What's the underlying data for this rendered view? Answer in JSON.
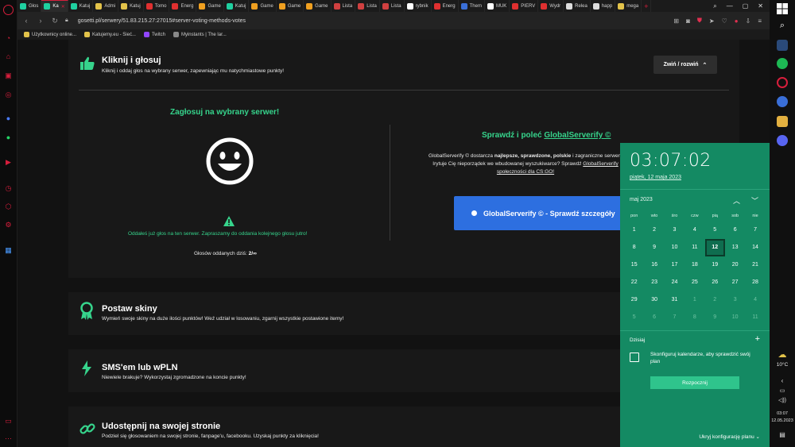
{
  "browser": {
    "tabs": [
      {
        "label": "Głos",
        "color": "#1fd0a0"
      },
      {
        "label": "Ka",
        "color": "#1fd0a0",
        "active": true
      },
      {
        "label": "Katuj",
        "color": "#1fd0a0"
      },
      {
        "label": "Admi",
        "color": "#e3c34a"
      },
      {
        "label": "Katuj",
        "color": "#e3c34a"
      },
      {
        "label": "Tomo",
        "color": "#e03030"
      },
      {
        "label": "Energ",
        "color": "#e03030"
      },
      {
        "label": "Game",
        "color": "#f0a020"
      },
      {
        "label": "Katuj",
        "color": "#1fd0a0"
      },
      {
        "label": "Game",
        "color": "#f0a020"
      },
      {
        "label": "Game",
        "color": "#f0a020"
      },
      {
        "label": "Game",
        "color": "#f0a020"
      },
      {
        "label": "Lista",
        "color": "#d04040"
      },
      {
        "label": "Lista",
        "color": "#d04040"
      },
      {
        "label": "Lista",
        "color": "#d04040"
      },
      {
        "label": "rybnik",
        "color": "#ffffff"
      },
      {
        "label": "Energ",
        "color": "#e03030"
      },
      {
        "label": "Them",
        "color": "#3a6fd8"
      },
      {
        "label": "MUK",
        "color": "#ffffff"
      },
      {
        "label": "PIERV",
        "color": "#e03030"
      },
      {
        "label": "Wydr",
        "color": "#e03030"
      },
      {
        "label": "Relea",
        "color": "#dddddd"
      },
      {
        "label": "happ",
        "color": "#dddddd"
      },
      {
        "label": "mega",
        "color": "#e3c34a"
      }
    ],
    "url": "gosetti.pl/serwery/51.83.215.27:27015#server-voting-methods-votes",
    "bookmarks": [
      "Użytkownicy online...",
      "Katujemy.eu - Sieć...",
      "Twitch",
      "Myinstants | The lar..."
    ]
  },
  "vote_card": {
    "title": "Kliknij i głosuj",
    "desc": "Kliknij i oddaj głos na wybrany serwer, zapewniając mu natychmiastowe punkty!",
    "collapse": "Zwiń / rozwiń",
    "vote_title": "Zagłosuj na wybrany serwer!",
    "already": "Oddałeś już głos na ten serwer. Zapraszamy do oddania kolejnego głosu jutro!",
    "count_label": "Głosów oddanych dziś:",
    "count_value": "2/∞",
    "gs_prefix": "Sprawdź i poleć",
    "gs_link": "GlobalServerify ©",
    "gs_desc_1": "GlobalServerify © dostarcza",
    "gs_desc_b1": "najlepsze, sprawdzone, polskie",
    "gs_desc_2": "i zagraniczne serwery",
    "gs_desc_3": "Irytuje Cię nieporządek we wbudowanej wyszukiwarce? Sprawdź",
    "gs_desc_link": "GlobalServerify",
    "gs_desc_4": "społeczności dla CS:GO!",
    "gs_button": "GlobalServerify © - Sprawdź szczegóły"
  },
  "cards": [
    {
      "title": "Postaw skiny",
      "desc": "Wymień swoje skiny na duże ilości punktów! Weź udział w losowaniu, zgarnij wszystkie postawione itemy!"
    },
    {
      "title": "SMS'em lub wPLN",
      "desc": "Niewiele brakuje? Wykorzystaj zgromadzone na koncie punkty!"
    },
    {
      "title": "Udostępnij na swojej stronie",
      "desc": "Podziel się głosowaniem na swojej stronie, fanpage'u, facebooku. Uzyskaj punkty za kliknięcia!"
    }
  ],
  "calendar": {
    "time": "03:07:02",
    "date": "piątek, 12 maja 2023",
    "month": "maj 2023",
    "weekdays": [
      "pon",
      "wto",
      "śro",
      "czw",
      "pią",
      "sob",
      "nie"
    ],
    "days": [
      [
        "1",
        "2",
        "3",
        "4",
        "5",
        "6",
        "7"
      ],
      [
        "8",
        "9",
        "10",
        "11",
        "12",
        "13",
        "14"
      ],
      [
        "15",
        "16",
        "17",
        "18",
        "19",
        "20",
        "21"
      ],
      [
        "22",
        "23",
        "24",
        "25",
        "26",
        "27",
        "28"
      ],
      [
        "29",
        "30",
        "31",
        "1",
        "2",
        "3",
        "4"
      ],
      [
        "5",
        "6",
        "7",
        "8",
        "9",
        "10",
        "11"
      ]
    ],
    "today_day": "12",
    "today_label": "Dzisiaj",
    "event_text": "Skonfiguruj kalendarze, aby sprawdzić swój plan",
    "start_button": "Rozpocznij",
    "hide_plan": "Ukryj konfigurację planu"
  },
  "tray": {
    "temp": "10°C",
    "clock_time": "03:07",
    "clock_date": "12.05.2023"
  }
}
